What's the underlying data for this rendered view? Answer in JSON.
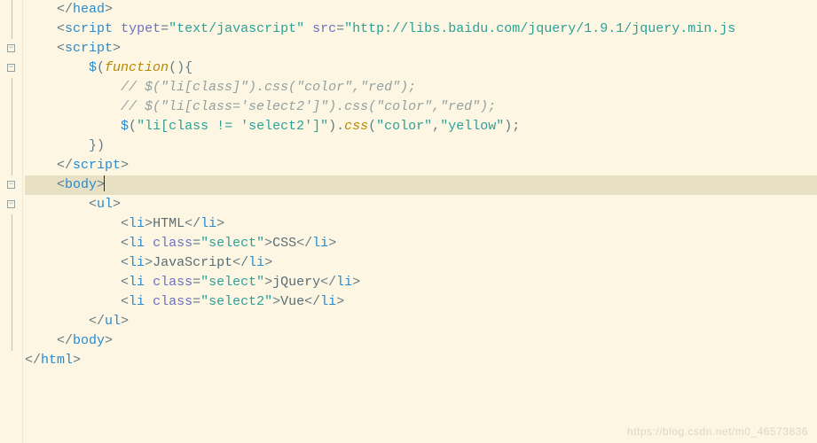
{
  "colors": {
    "background": "#fdf6e3",
    "highlight_line_bg": "#e8e0c2",
    "tag": "#268bd2",
    "attribute": "#6c71c4",
    "string": "#2aa198",
    "function": "#b58900",
    "comment": "#93a1a1",
    "text": "#586e75"
  },
  "watermark": "https://blog.csdn.net/m0_46573836",
  "gutter": [
    {
      "fold": null
    },
    {
      "fold": null
    },
    {
      "fold": "open"
    },
    {
      "fold": "open"
    },
    {
      "fold": null
    },
    {
      "fold": null
    },
    {
      "fold": null
    },
    {
      "fold": null
    },
    {
      "fold": null
    },
    {
      "fold": "open"
    },
    {
      "fold": "open"
    },
    {
      "fold": null
    },
    {
      "fold": null
    },
    {
      "fold": null
    },
    {
      "fold": null
    },
    {
      "fold": null
    },
    {
      "fold": null
    },
    {
      "fold": null
    },
    {
      "fold": null
    }
  ],
  "lines": {
    "l0": {
      "indent": "    ",
      "open": "</",
      "tag": "head",
      "close": ">"
    },
    "l1": {
      "indent": "    ",
      "open": "<",
      "tag": "script",
      "sp1": " ",
      "attr1": "typet",
      "eq1": "=",
      "val1": "\"text/javascript\"",
      "sp2": " ",
      "attr2": "src",
      "eq2": "=",
      "val2": "\"http://libs.baidu.com/jquery/1.9.1/jquery.min.js"
    },
    "l2": {
      "indent": "    ",
      "open": "<",
      "tag": "script",
      "close": ">"
    },
    "l3": {
      "indent": "        ",
      "dollar": "$",
      "p1": "(",
      "fn": "function",
      "p2": "(){"
    },
    "l4": {
      "indent": "            ",
      "comment": "// $(\"li[class]\").css(\"color\",\"red\");"
    },
    "l5": {
      "indent": "            ",
      "comment": "// $(\"li[class='select2']\").css(\"color\",\"red\");"
    },
    "l6": {
      "indent": "            ",
      "dollar": "$",
      "p1": "(",
      "arg1": "\"li[class != 'select2']\"",
      "p2": ").",
      "m": "css",
      "p3": "(",
      "arg2": "\"color\"",
      "comma": ",",
      "arg3": "\"yellow\"",
      "p4": ");"
    },
    "l7": {
      "indent": "        ",
      "close": "})"
    },
    "l8": {
      "indent": "    ",
      "open": "</",
      "tag": "script",
      "close": ">"
    },
    "l9": {
      "indent": "    ",
      "open": "<",
      "tag": "body",
      "close": ">"
    },
    "l10": {
      "indent": "        ",
      "open": "<",
      "tag": "ul",
      "close": ">"
    },
    "l11": {
      "indent": "            ",
      "open": "<",
      "tag1": "li",
      "c1": ">",
      "text": "HTML",
      "open2": "</",
      "tag2": "li",
      "c2": ">"
    },
    "l12": {
      "indent": "            ",
      "open": "<",
      "tag1": "li",
      "sp": " ",
      "attr": "class",
      "eq": "=",
      "val": "\"select\"",
      "c1": ">",
      "text": "CSS",
      "open2": "</",
      "tag2": "li",
      "c2": ">"
    },
    "l13": {
      "indent": "            ",
      "open": "<",
      "tag1": "li",
      "c1": ">",
      "text": "JavaScript",
      "open2": "</",
      "tag2": "li",
      "c2": ">"
    },
    "l14": {
      "indent": "            ",
      "open": "<",
      "tag1": "li",
      "sp": " ",
      "attr": "class",
      "eq": "=",
      "val": "\"select\"",
      "c1": ">",
      "text": "jQuery",
      "open2": "</",
      "tag2": "li",
      "c2": ">"
    },
    "l15": {
      "indent": "            ",
      "open": "<",
      "tag1": "li",
      "sp": " ",
      "attr": "class",
      "eq": "=",
      "val": "\"select2\"",
      "c1": ">",
      "text": "Vue",
      "open2": "</",
      "tag2": "li",
      "c2": ">"
    },
    "l16": {
      "indent": "        ",
      "open": "</",
      "tag": "ul",
      "close": ">"
    },
    "l17": {
      "indent": "    ",
      "open": "</",
      "tag": "body",
      "close": ">"
    },
    "l18": {
      "indent": "",
      "open": "</",
      "tag": "html",
      "close": ">"
    }
  }
}
